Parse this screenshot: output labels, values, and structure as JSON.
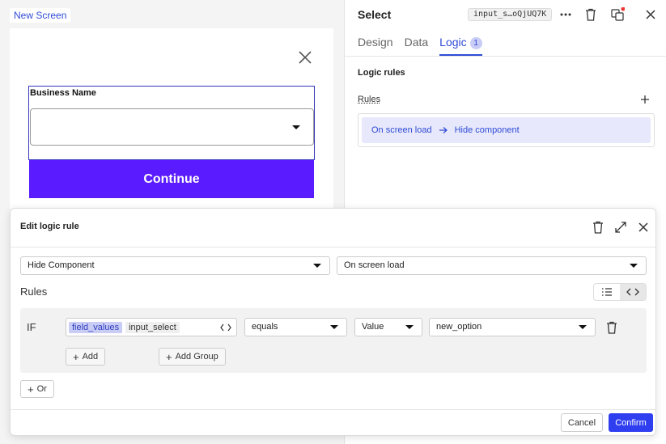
{
  "canvas": {
    "screen_tag": "New Screen",
    "field_label": "Business Name",
    "continue_label": "Continue"
  },
  "panel": {
    "title": "Select",
    "component_id": "input_s…oQjUQ7K",
    "tabs": [
      {
        "label": "Design"
      },
      {
        "label": "Data"
      },
      {
        "label": "Logic",
        "badge": "1"
      }
    ],
    "section_title": "Logic rules",
    "rules_label": "Rules",
    "rule": {
      "trigger": "On screen load",
      "action": "Hide component"
    }
  },
  "modal": {
    "title": "Edit logic rule",
    "action_select": "Hide Component",
    "trigger_select": "On screen load",
    "rules_heading": "Rules",
    "condition": {
      "if_label": "IF",
      "field_chip": "field_values",
      "field_name": "input_select",
      "operator": "equals",
      "value_type": "Value",
      "value": "new_option"
    },
    "add_label": "Add",
    "add_group_label": "Add Group",
    "or_label": "Or",
    "cancel_label": "Cancel",
    "confirm_label": "Confirm"
  },
  "colors": {
    "accent": "#2f4bd6",
    "continue_button": "#5a1bff",
    "confirm_button": "#2f3ff0"
  }
}
